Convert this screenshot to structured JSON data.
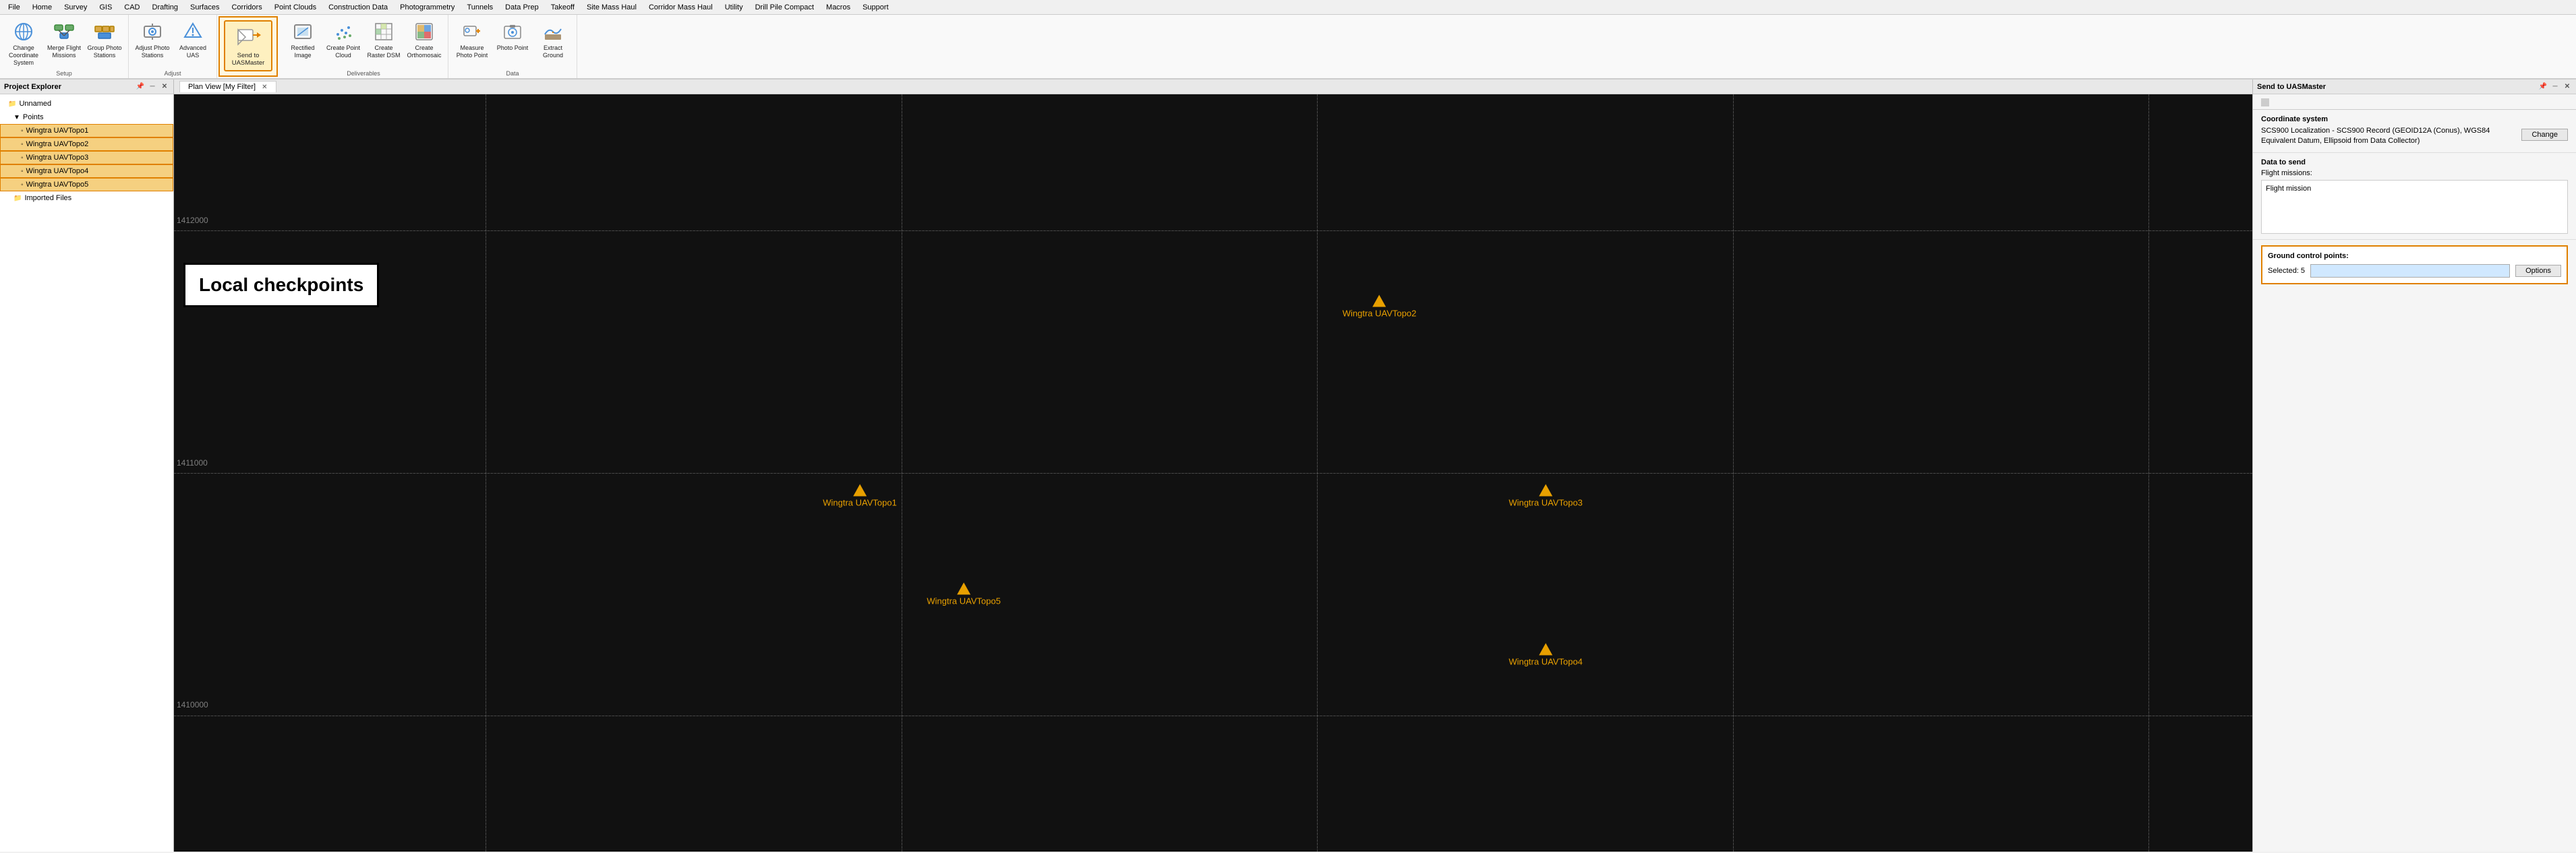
{
  "menuBar": {
    "items": [
      "File",
      "Home",
      "Survey",
      "GIS",
      "CAD",
      "Drafting",
      "Surfaces",
      "Corridors",
      "Point Clouds",
      "Construction Data",
      "Photogrammetry",
      "Tunnels",
      "Data Prep",
      "Takeoff",
      "Site Mass Haul",
      "Corridor Mass Haul",
      "Utility",
      "Drill Pile Compact",
      "Macros",
      "Support"
    ]
  },
  "ribbon": {
    "groups": [
      {
        "label": "Setup",
        "buttons": [
          {
            "id": "change-coordinate",
            "label": "Change Coordinate System",
            "icon": "coordinate"
          },
          {
            "id": "merge-flight",
            "label": "Merge Flight Missions",
            "icon": "merge"
          },
          {
            "id": "group-photo",
            "label": "Group Photo Stations",
            "icon": "group"
          }
        ]
      },
      {
        "label": "Adjust",
        "buttons": [
          {
            "id": "adjust-photo",
            "label": "Adjust Photo Stations",
            "icon": "adjust"
          },
          {
            "id": "advanced-uas",
            "label": "Advanced UAS",
            "icon": "advanced"
          }
        ]
      },
      {
        "label": "",
        "buttons": [
          {
            "id": "send-to-uasmaster",
            "label": "Send to UASMaster",
            "icon": "send",
            "active": true
          }
        ]
      },
      {
        "label": "Deliverables",
        "buttons": [
          {
            "id": "rectified-image",
            "label": "Rectified Image",
            "icon": "rectified"
          },
          {
            "id": "create-point-cloud",
            "label": "Create Point Cloud",
            "icon": "pointcloud"
          },
          {
            "id": "create-raster-dsm",
            "label": "Create Raster DSM",
            "icon": "raster"
          },
          {
            "id": "create-orthomosaic",
            "label": "Create Orthomosaic",
            "icon": "ortho"
          }
        ]
      },
      {
        "label": "Data",
        "buttons": [
          {
            "id": "measure-photo-point",
            "label": "Measure Photo Point",
            "icon": "measure"
          },
          {
            "id": "photo-point",
            "label": "Photo Point",
            "icon": "photo"
          },
          {
            "id": "extract-ground",
            "label": "Extract Ground",
            "icon": "extract"
          }
        ]
      }
    ]
  },
  "projectExplorer": {
    "title": "Project Explorer",
    "items": [
      {
        "id": "unnamed",
        "label": "Unnamed",
        "indent": 0,
        "icon": "folder",
        "expanded": true
      },
      {
        "id": "points",
        "label": "Points",
        "indent": 1,
        "icon": "points",
        "expanded": true
      },
      {
        "id": "wingtra1",
        "label": "Wingtra UAVTopo1",
        "indent": 2,
        "icon": "uav",
        "selected": true
      },
      {
        "id": "wingtra2",
        "label": "Wingtra UAVTopo2",
        "indent": 2,
        "icon": "uav",
        "selected": true
      },
      {
        "id": "wingtra3",
        "label": "Wingtra UAVTopo3",
        "indent": 2,
        "icon": "uav",
        "selected": true
      },
      {
        "id": "wingtra4",
        "label": "Wingtra UAVTopo4",
        "indent": 2,
        "icon": "uav",
        "selected": true
      },
      {
        "id": "wingtra5",
        "label": "Wingtra UAVTopo5",
        "indent": 2,
        "icon": "uav",
        "selected": true
      },
      {
        "id": "imported",
        "label": "Imported Files",
        "indent": 1,
        "icon": "folder",
        "selected": false
      }
    ]
  },
  "planView": {
    "title": "Plan View [My Filter]",
    "gridLabels": [
      "1412000",
      "1411000",
      "1410000"
    ],
    "points": [
      {
        "id": "pt1",
        "label": "Wingtra UAVTopo1",
        "x": 33,
        "y": 53
      },
      {
        "id": "pt2",
        "label": "Wingtra UAVTopo2",
        "x": 58,
        "y": 28
      },
      {
        "id": "pt3",
        "label": "Wingtra UAVTopo3",
        "x": 66,
        "y": 53
      },
      {
        "id": "pt4",
        "label": "Wingtra UAVTopo4",
        "x": 66,
        "y": 73
      },
      {
        "id": "pt5",
        "label": "Wingtra UAVTopo5",
        "x": 38,
        "y": 66
      }
    ],
    "localCheckpoints": "Local checkpoints"
  },
  "uasMasterPanel": {
    "title": "Send to UASMaster",
    "coordinateSystem": {
      "label": "Coordinate system",
      "value": "SCS900 Localization - SCS900 Record (GEOID12A (Conus), WGS84 Equivalent Datum, Ellipsoid from Data Collector)",
      "changeLabel": "Change"
    },
    "dataToSend": {
      "label": "Data to send",
      "flightMissionsLabel": "Flight missions:",
      "flightMission": "Flight mission"
    },
    "groundControlPoints": {
      "label": "Ground control points:",
      "selectedLabel": "Selected: 5",
      "optionsLabel": "Options"
    }
  },
  "colors": {
    "accent": "#e08000",
    "selected": "#f5d080",
    "mapPoint": "#e8a000",
    "gcpBorder": "#e08000"
  }
}
